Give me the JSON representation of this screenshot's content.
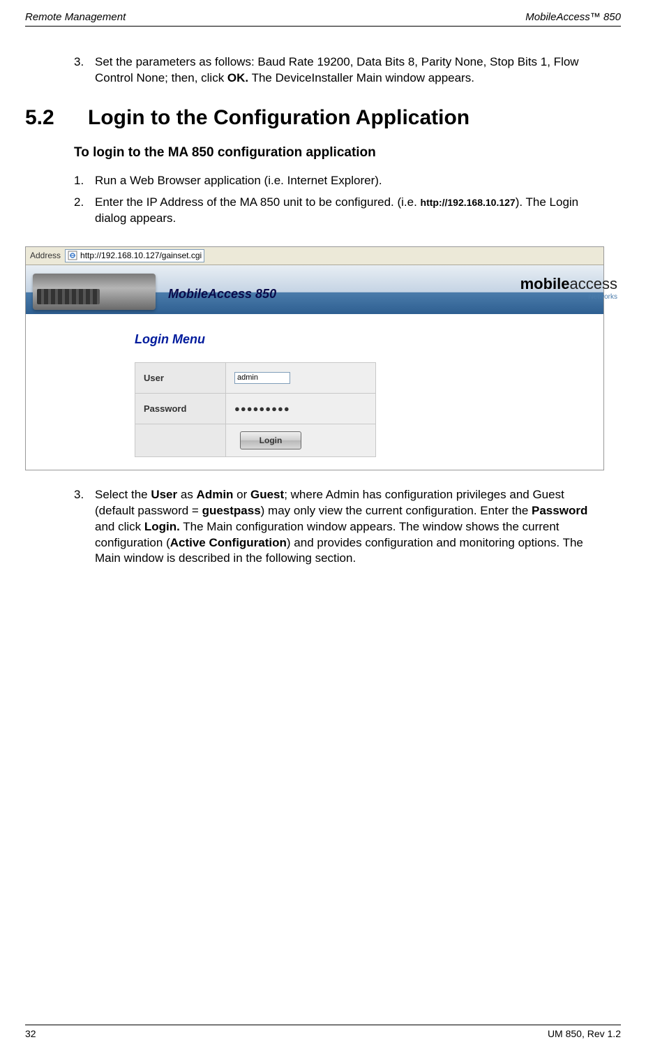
{
  "header": {
    "left": "Remote Management",
    "right": "MobileAccess™  850"
  },
  "footer": {
    "left": "32",
    "right": "UM 850, Rev 1.2"
  },
  "intro": {
    "num": "3.",
    "text_before": "Set the parameters as follows: Baud Rate 19200, Data Bits 8, Parity None, Stop Bits 1, Flow Control None; then, click ",
    "ok": "OK.",
    "text_after": " The DeviceInstaller Main window appears."
  },
  "section": {
    "number": "5.2",
    "title": "Login to the Configuration Application"
  },
  "subheading": "To login to the MA 850 configuration application",
  "step1": {
    "num": "1.",
    "text": "Run a Web Browser application (i.e. Internet Explorer)."
  },
  "step2": {
    "num": "2.",
    "text_before": "Enter the IP Address of the MA 850 unit to be configured. (i.e. ",
    "url": "http://192.168.10.127",
    "text_after": "). The Login dialog appears."
  },
  "screenshot": {
    "address_label": "Address",
    "address_url": "http://192.168.10.127/gainset.cgi",
    "banner_title": "MobileAccess 850",
    "brand_bold": "mobile",
    "brand_light": "access",
    "brand_sub": "Networks",
    "login_title": "Login Menu",
    "user_label": "User",
    "user_value": "admin",
    "password_label": "Password",
    "password_value": "●●●●●●●●●",
    "login_button": "Login"
  },
  "step3": {
    "num": "3.",
    "p1": "Select the ",
    "user": "User",
    "p2": " as ",
    "admin": "Admin",
    "p3": " or ",
    "guest": "Guest",
    "p4": "; where Admin has configuration privileges and Guest (default password = ",
    "guestpass": "guestpass",
    "p5": ") may only view the current configuration. Enter the ",
    "password": "Password",
    "p6": " and click ",
    "login": "Login.",
    "p7": "  The Main configuration window appears. The window shows the current configuration (",
    "active": "Active Configuration",
    "p8": ") and provides configuration and monitoring options. The Main window is described in the following section."
  }
}
